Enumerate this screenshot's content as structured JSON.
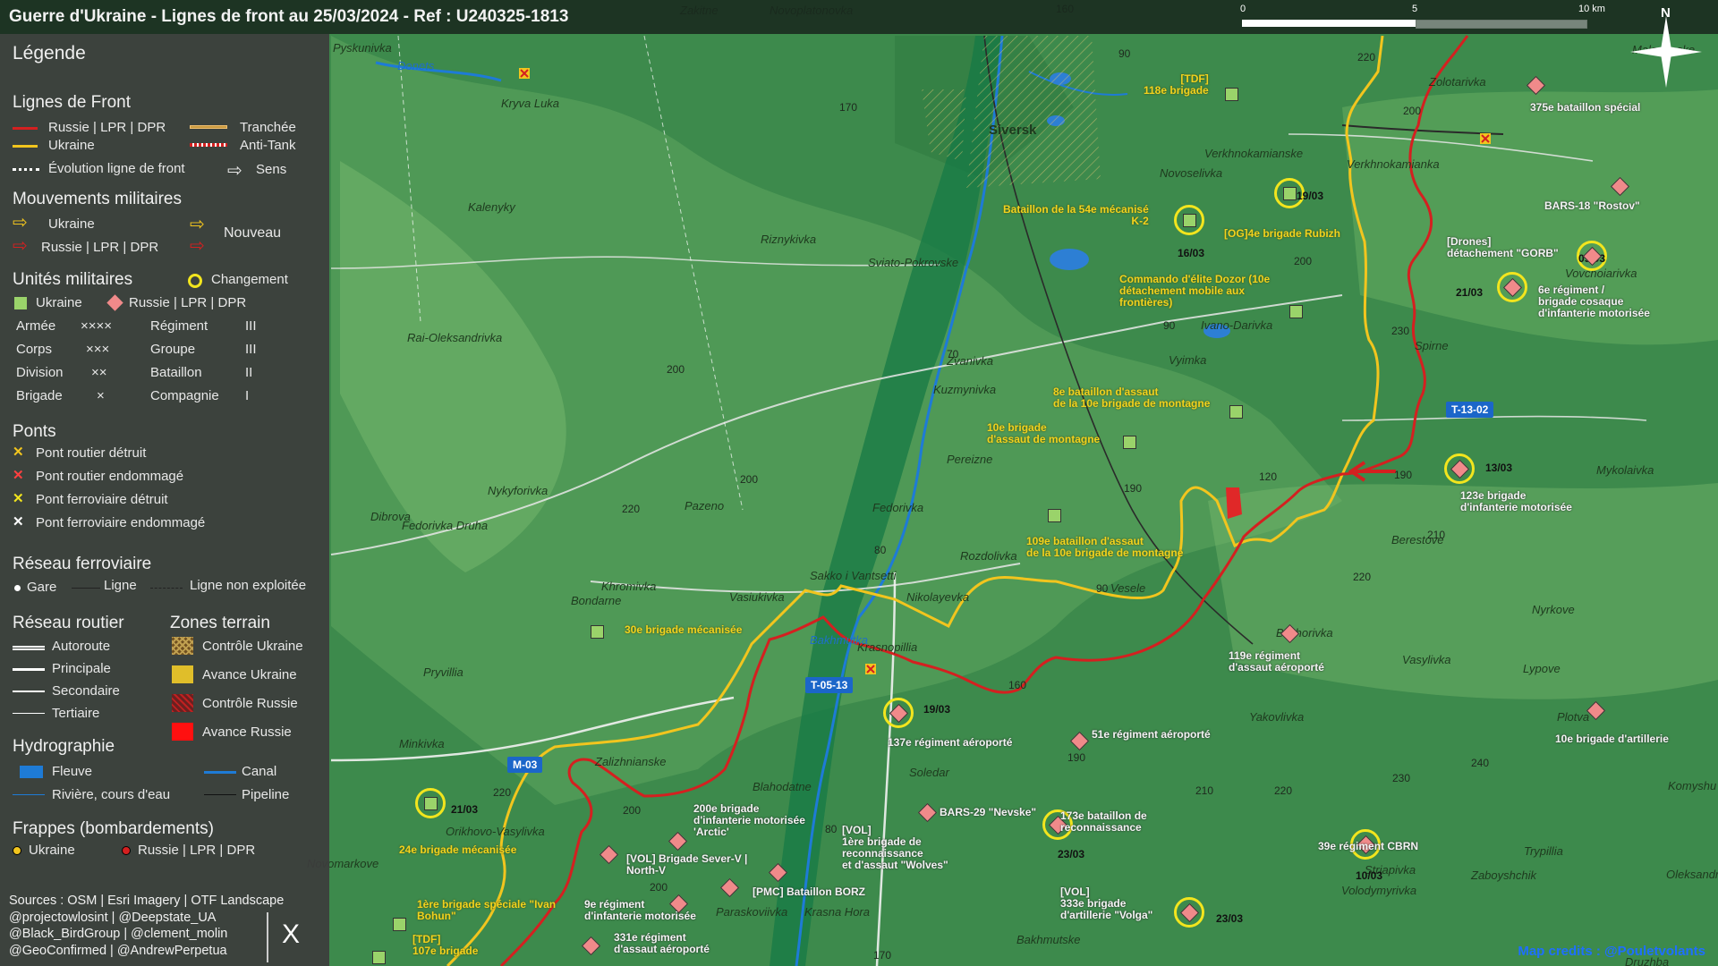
{
  "title": "Guerre d'Ukraine - Lignes de front au 25/03/2024 - Ref : U240325-1813",
  "scale": {
    "t0": "0",
    "t1": "5",
    "t2": "10 km"
  },
  "north": "N",
  "credit": "Map credits : @Pouletvolants",
  "legend": {
    "title": "Légende",
    "front_heading": "Lignes de Front",
    "russia_line": "Russie | LPR | DPR",
    "ukraine_line": "Ukraine",
    "trench": "Tranchée",
    "antitank": "Anti-Tank",
    "evolution": "Évolution ligne de front",
    "direction": "Sens",
    "mov_heading": "Mouvements militaires",
    "mov_ukraine": "Ukraine",
    "mov_russia": "Russie | LPR | DPR",
    "mov_new": "Nouveau",
    "units_heading": "Unités militaires",
    "units_change": "Changement",
    "units_ukraine": "Ukraine",
    "units_russia": "Russie | LPR | DPR",
    "army": "Armée",
    "army_sym": "××××",
    "regiment": "Régiment",
    "regiment_sym": "III",
    "corps": "Corps",
    "corps_sym": "×××",
    "group": "Groupe",
    "group_sym": "III",
    "division": "Division",
    "division_sym": "××",
    "battalion": "Bataillon",
    "battalion_sym": "II",
    "brigade": "Brigade",
    "brigade_sym": "×",
    "company": "Compagnie",
    "company_sym": "I",
    "bridges_heading": "Ponts",
    "bridge1": "Pont routier détruit",
    "bridge2": "Pont routier endommagé",
    "bridge3": "Pont ferroviaire détruit",
    "bridge4": "Pont ferroviaire endommagé",
    "rail_heading": "Réseau ferroviaire",
    "rail_station": "Gare",
    "rail_line": "Ligne",
    "rail_unused": "Ligne non exploitée",
    "road_heading": "Réseau routier",
    "road1": "Autoroute",
    "road2": "Principale",
    "road3": "Secondaire",
    "road4": "Tertiaire",
    "zones_heading": "Zones terrain",
    "zone1": "Contrôle Ukraine",
    "zone2": "Avance Ukraine",
    "zone3": "Contrôle Russie",
    "zone4": "Avance Russie",
    "hydro_heading": "Hydrographie",
    "river": "Fleuve",
    "canal": "Canal",
    "stream": "Rivière, cours d'eau",
    "pipeline": "Pipeline",
    "strikes_heading": "Frappes (bombardements)",
    "strike_ukraine": "Ukraine",
    "strike_russia": "Russie | LPR | DPR"
  },
  "sources": [
    "Sources : OSM | Esri Imagery | OTF Landscape",
    "@projectowlosint | @Deepstate_UA",
    "@Black_BirdGroup | @clement_molin",
    "@GeoConfirmed | @AndrewPerpetua"
  ],
  "x_logo": "X",
  "colors": {
    "russia": "#d42020",
    "ukraine": "#f0c020",
    "terrain": "#3e8a4e",
    "legend_bg": "#3c3c3c"
  },
  "road_badges": [
    "T-13-02",
    "T-05-13",
    "M-03"
  ],
  "places": [
    "Zakitne",
    "Novoplatonovka",
    "Pyskunivka",
    "Donets",
    "Kryva Luka",
    "Siversk",
    "Kalenyky",
    "Riznykivka",
    "Sviato-Pokrovske",
    "Rai-Oleksandrivka",
    "Zvanivka",
    "Kuzmynivka",
    "Pereizne",
    "Nykyforivka",
    "Pazeno",
    "Dibrova",
    "Fedorivka Druha",
    "Fedorivka",
    "Rozdolivka",
    "Vesele",
    "Khromivka",
    "Vasiukivka",
    "Bondarne",
    "Sakko i Vantsetti",
    "Nikolayevka",
    "Krasnopillia",
    "Bakhmutka",
    "Pryvillia",
    "Minkivka",
    "Zalizhnianske",
    "Blahodatne",
    "Soledar",
    "Orikhovo-Vasylivka",
    "Paraskoviivka",
    "Krasna Hora",
    "Bakhmutske",
    "Novoselivka",
    "Verkhnokamianske",
    "Verkhnokamianka",
    "Zolotarivka",
    "Vyimka",
    "Ivano-Darivka",
    "Spirne",
    "Vovchoiarivka",
    "Mykolaivka",
    "Berestove",
    "Bilohorivka",
    "Vasylivka",
    "Lypove",
    "Nyrkove",
    "Yakovlivka",
    "Plotva",
    "Trypillia",
    "Zaboyshchik",
    "Striapivka",
    "Volodymyrivka",
    "Oleksandr",
    "Komyshu",
    "Malorianske",
    "Novomarkove",
    "Druzhba"
  ],
  "units": [
    {
      "label": "[TDF]\n118e brigade",
      "side": "ua"
    },
    {
      "label": "375e bataillon spécial",
      "side": "ru"
    },
    {
      "label": "Bataillon de la 54e mécanisé\nK-2",
      "side": "ua",
      "date": "16/03"
    },
    {
      "label": "[OG]4e brigade Rubizh",
      "side": "ua",
      "date": "19/03"
    },
    {
      "label": "BARS-18 \"Rostov\"",
      "side": "ru"
    },
    {
      "label": "[Drones]\ndétachement \"GORB\"",
      "side": "ru",
      "date": "09/03"
    },
    {
      "label": "Commando d'élite Dozor (10e\ndétachement mobile aux\nfrontières)",
      "side": "ua"
    },
    {
      "label": "6e régiment /\nbrigade cosaque\nd'infanterie motorisée",
      "side": "ru",
      "date": "21/03"
    },
    {
      "label": "8e bataillon d'assaut\nde la 10e brigade de montagne",
      "side": "ua"
    },
    {
      "label": "10e brigade\nd'assaut de montagne",
      "side": "ua"
    },
    {
      "label": "123e brigade\nd'infanterie motorisée",
      "side": "ru",
      "date": "13/03"
    },
    {
      "label": "109e bataillon d'assaut\nde la 10e brigade de montagne",
      "side": "ua"
    },
    {
      "label": "30e brigade mécanisée",
      "side": "ua"
    },
    {
      "label": "119e régiment\nd'assaut aéroporté",
      "side": "ru"
    },
    {
      "label": "137e régiment aéroporté",
      "side": "ru",
      "date": "19/03"
    },
    {
      "label": "51e régiment aéroporté",
      "side": "ru"
    },
    {
      "label": "10e brigade d'artillerie",
      "side": "ru"
    },
    {
      "label": "24e brigade mécanisée",
      "side": "ua",
      "date": "21/03"
    },
    {
      "label": "200e brigade\nd'infanterie motorisée\n'Arctic'",
      "side": "ru"
    },
    {
      "label": "BARS-29 \"Nevske\"",
      "side": "ru"
    },
    {
      "label": "173e bataillon de\nreconnaissance",
      "side": "ru",
      "date": "23/03"
    },
    {
      "label": "[VOL]\n1ère brigade de\nreconnaissance\net d'assaut \"Wolves\"",
      "side": "ru"
    },
    {
      "label": "[VOL] Brigade Sever-V |\nNorth-V",
      "side": "ru"
    },
    {
      "label": "39e régiment CBRN",
      "side": "ru",
      "date": "10/03"
    },
    {
      "label": "[PMC] Bataillon BORZ",
      "side": "ru"
    },
    {
      "label": "9e régiment\nd'infanterie motorisée",
      "side": "ru"
    },
    {
      "label": "[VOL]\n333e brigade\nd'artillerie \"Volga\"",
      "side": "ru",
      "date": "23/03"
    },
    {
      "label": "1ère brigade spéciale \"Ivan\nBohun\"",
      "side": "ua"
    },
    {
      "label": "331e régiment\nd'assaut aéroporté",
      "side": "ru"
    },
    {
      "label": "[TDF]\n107e brigade",
      "side": "ua"
    }
  ]
}
